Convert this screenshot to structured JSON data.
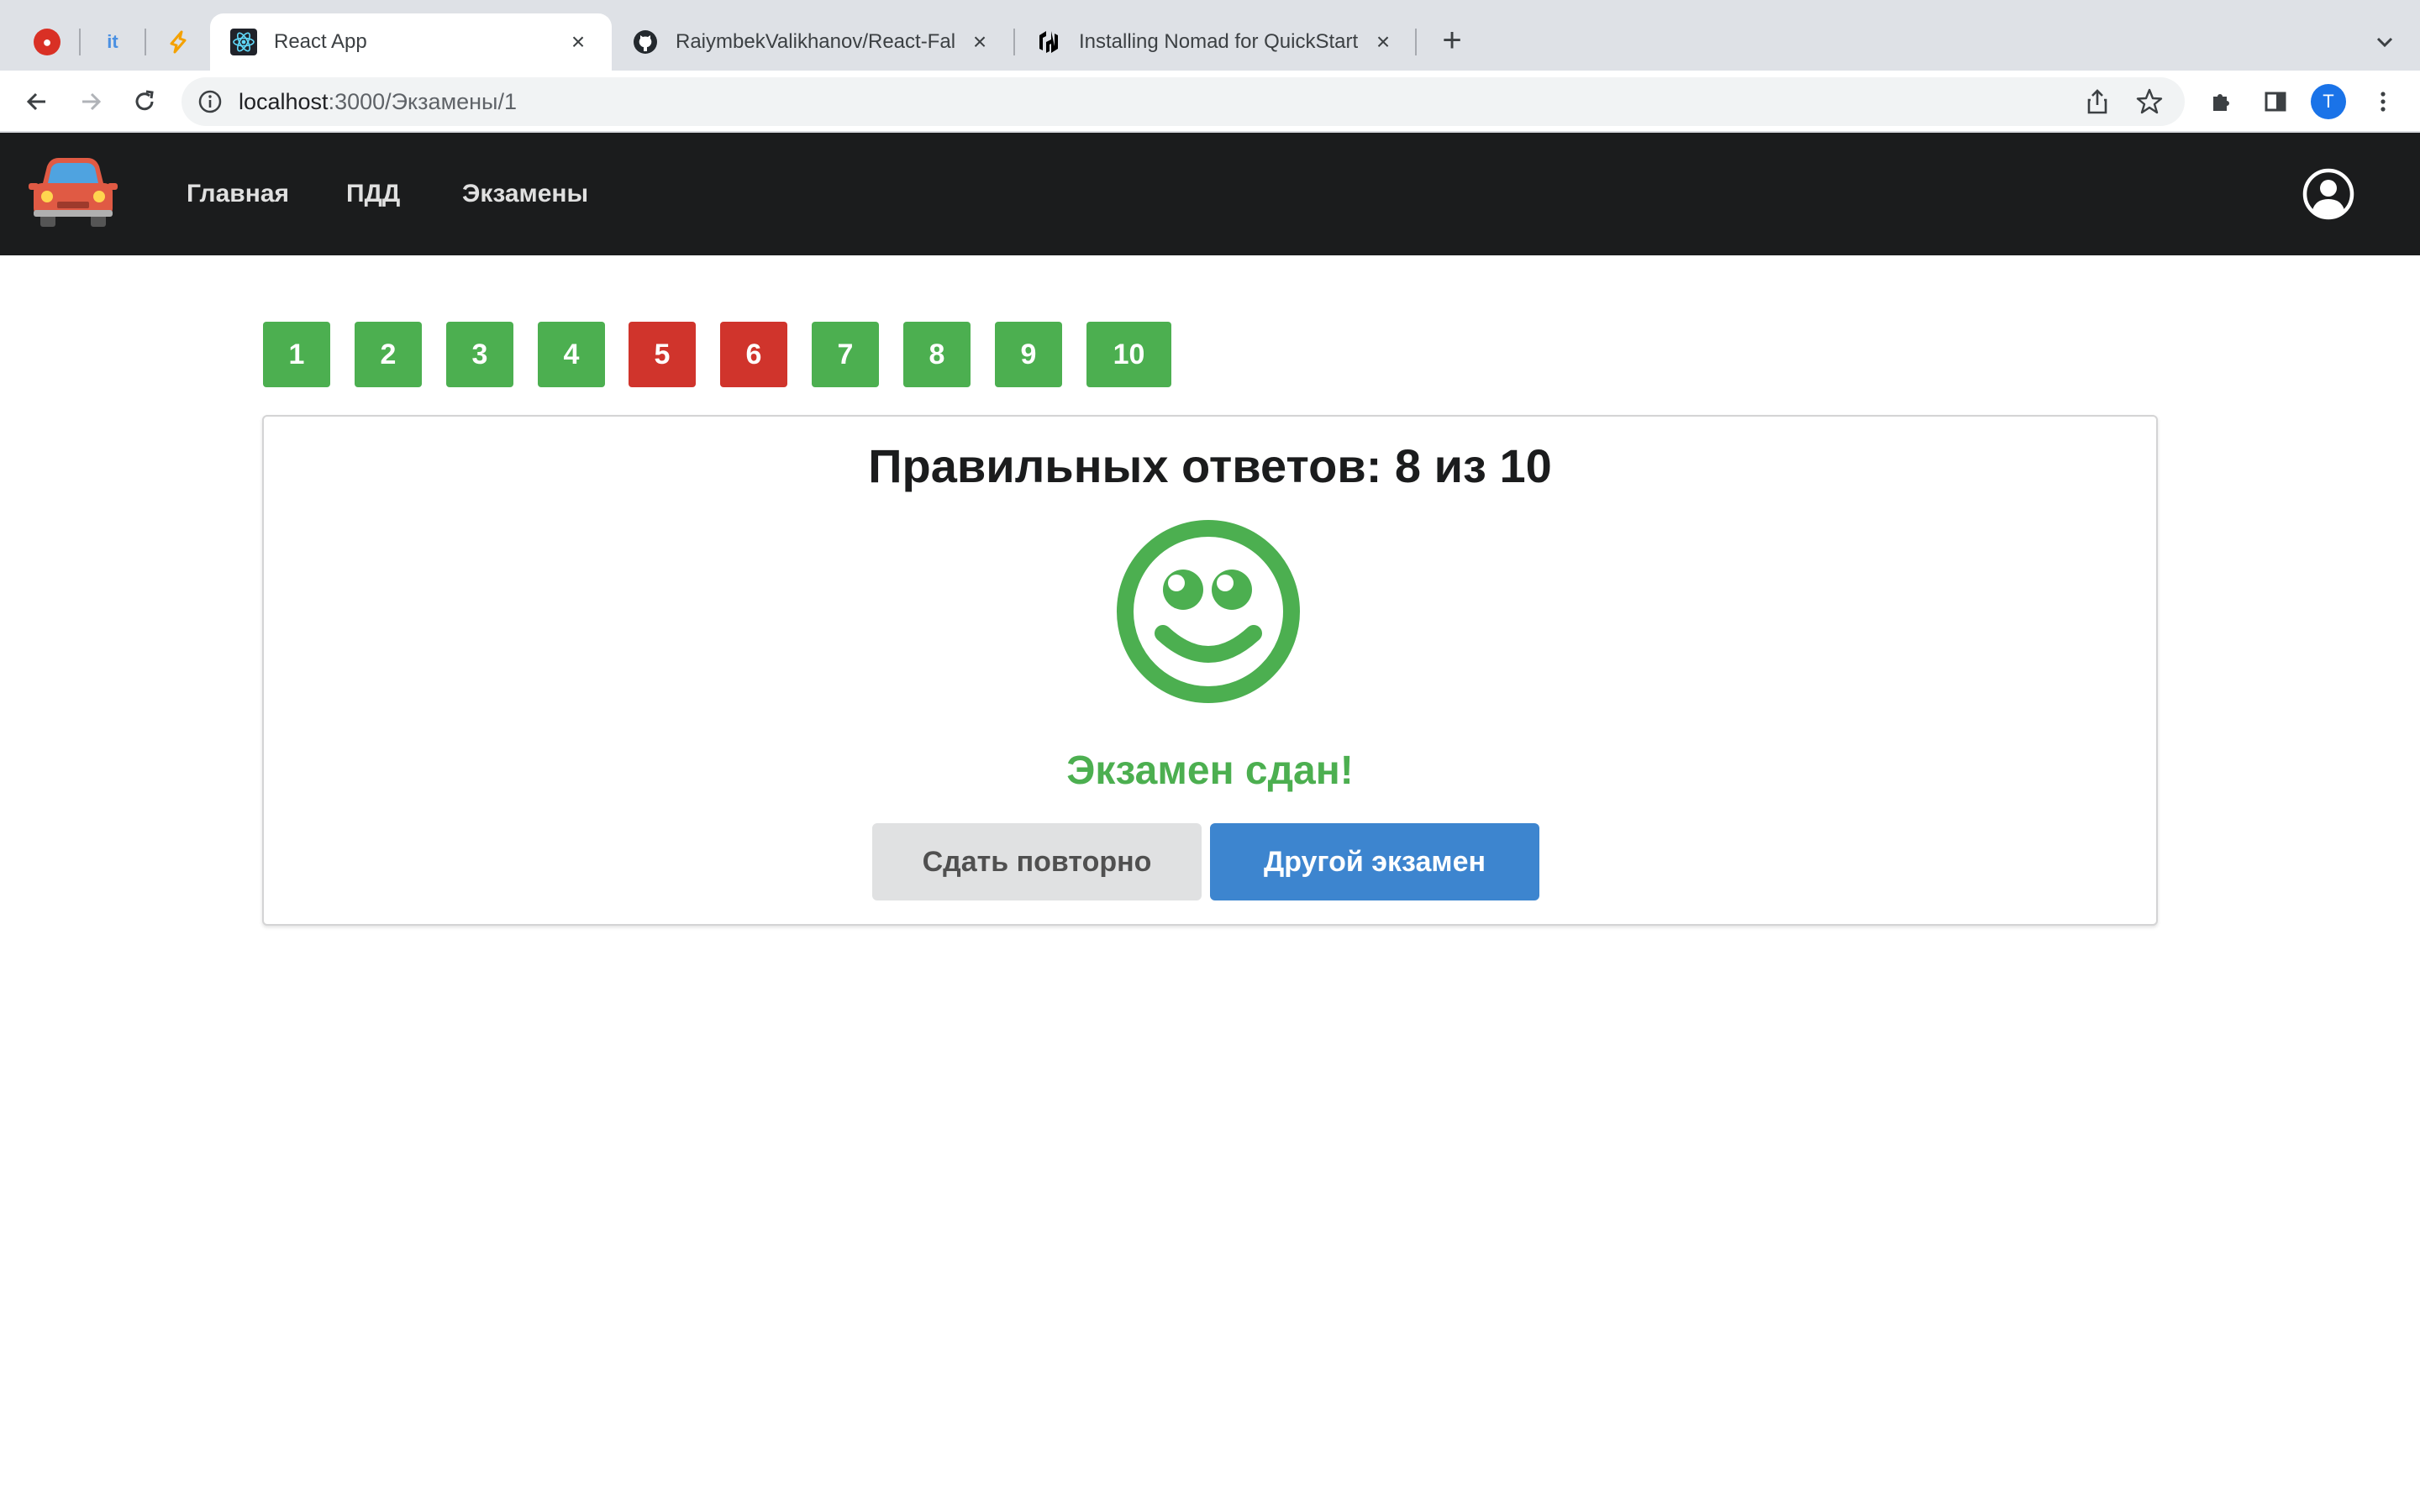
{
  "browser": {
    "pinned_tabs": [
      {
        "icon": "red-circle-icon",
        "color": "#d93025"
      },
      {
        "icon": "itc-logo-icon",
        "color": "#4a90e2"
      },
      {
        "icon": "pen-nib-icon",
        "color": "#f4a100"
      }
    ],
    "tabs": [
      {
        "title": "React App",
        "icon": "react-icon",
        "active": true
      },
      {
        "title": "RaiymbekValikhanov/React-Fal",
        "icon": "github-icon",
        "active": false
      },
      {
        "title": "Installing Nomad for QuickStart",
        "icon": "hashicorp-icon",
        "active": false
      }
    ],
    "address": {
      "host": "localhost",
      "path": ":3000/Экзамены/1"
    },
    "profile_initial": "T"
  },
  "navbar": {
    "items": [
      "Главная",
      "ПДД",
      "Экзамены"
    ],
    "logo": "car-logo-icon",
    "user_icon": "user-circle-icon"
  },
  "questions": [
    {
      "label": "1",
      "correct": true
    },
    {
      "label": "2",
      "correct": true
    },
    {
      "label": "3",
      "correct": true
    },
    {
      "label": "4",
      "correct": true
    },
    {
      "label": "5",
      "correct": false
    },
    {
      "label": "6",
      "correct": false
    },
    {
      "label": "7",
      "correct": true
    },
    {
      "label": "8",
      "correct": true
    },
    {
      "label": "9",
      "correct": true
    },
    {
      "label": "10",
      "correct": true
    }
  ],
  "result": {
    "title": "Правильных ответов: 8 из 10",
    "status": "Экзамен сдан!",
    "icon": "smile-icon",
    "retry_label": "Сдать повторно",
    "other_label": "Другой экзамен"
  },
  "colors": {
    "correct": "#4caf50",
    "incorrect": "#d0342c",
    "primary": "#3d85cf",
    "navbar": "#1b1c1d"
  }
}
